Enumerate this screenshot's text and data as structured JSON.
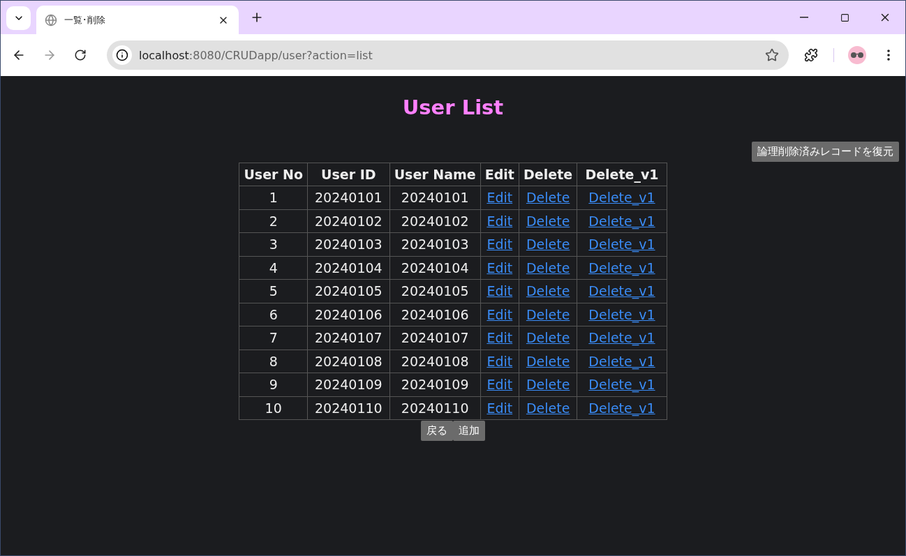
{
  "browser": {
    "tab_title": "一覧･削除",
    "url_host": "localhost",
    "url_rest": ":8080/CRUDapp/user?action=list"
  },
  "page": {
    "title": "User List",
    "restore_button": "論理削除済みレコードを復元"
  },
  "table": {
    "columns": [
      "User No",
      "User ID",
      "User Name",
      "Edit",
      "Delete",
      "Delete_v1"
    ],
    "rows": [
      {
        "no": "1",
        "user_id": "20240101",
        "user_name": "20240101",
        "edit": "Edit",
        "delete": "Delete",
        "delete_v1": "Delete_v1"
      },
      {
        "no": "2",
        "user_id": "20240102",
        "user_name": "20240102",
        "edit": "Edit",
        "delete": "Delete",
        "delete_v1": "Delete_v1"
      },
      {
        "no": "3",
        "user_id": "20240103",
        "user_name": "20240103",
        "edit": "Edit",
        "delete": "Delete",
        "delete_v1": "Delete_v1"
      },
      {
        "no": "4",
        "user_id": "20240104",
        "user_name": "20240104",
        "edit": "Edit",
        "delete": "Delete",
        "delete_v1": "Delete_v1"
      },
      {
        "no": "5",
        "user_id": "20240105",
        "user_name": "20240105",
        "edit": "Edit",
        "delete": "Delete",
        "delete_v1": "Delete_v1"
      },
      {
        "no": "6",
        "user_id": "20240106",
        "user_name": "20240106",
        "edit": "Edit",
        "delete": "Delete",
        "delete_v1": "Delete_v1"
      },
      {
        "no": "7",
        "user_id": "20240107",
        "user_name": "20240107",
        "edit": "Edit",
        "delete": "Delete",
        "delete_v1": "Delete_v1"
      },
      {
        "no": "8",
        "user_id": "20240108",
        "user_name": "20240108",
        "edit": "Edit",
        "delete": "Delete",
        "delete_v1": "Delete_v1"
      },
      {
        "no": "9",
        "user_id": "20240109",
        "user_name": "20240109",
        "edit": "Edit",
        "delete": "Delete",
        "delete_v1": "Delete_v1"
      },
      {
        "no": "10",
        "user_id": "20240110",
        "user_name": "20240110",
        "edit": "Edit",
        "delete": "Delete",
        "delete_v1": "Delete_v1"
      }
    ]
  },
  "buttons": [
    "戻る",
    "追加"
  ]
}
